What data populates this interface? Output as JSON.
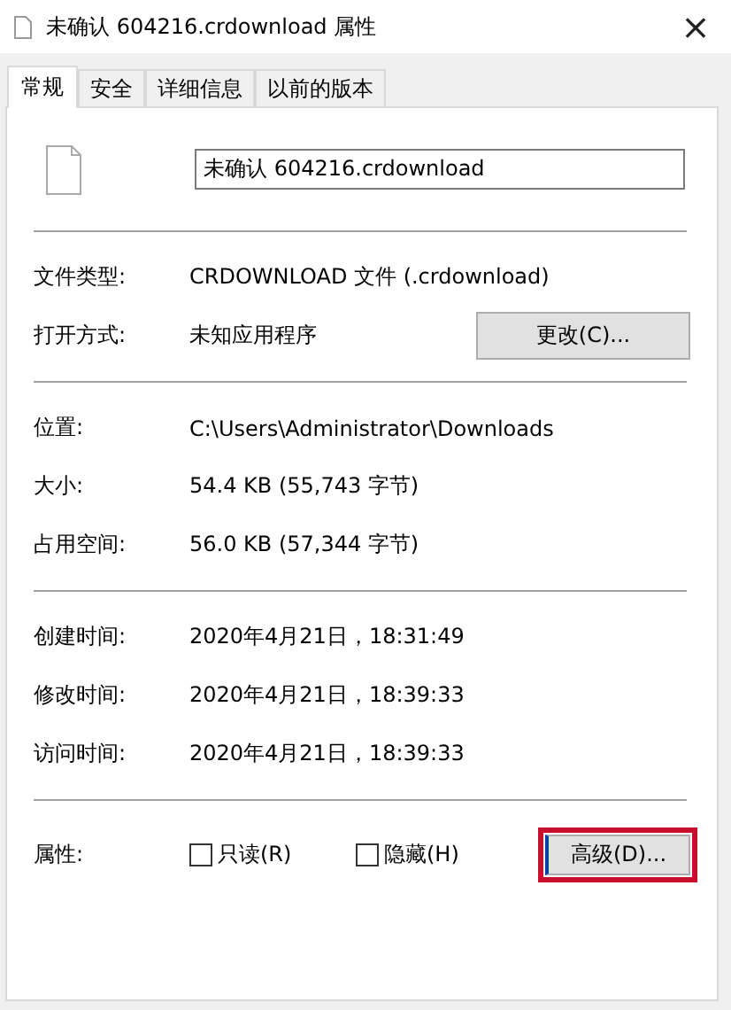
{
  "window": {
    "title": "未确认 604216.crdownload 属性",
    "close": "×"
  },
  "tabs": [
    {
      "label": "常规",
      "selected": true
    },
    {
      "label": "安全",
      "selected": false
    },
    {
      "label": "详细信息",
      "selected": false
    },
    {
      "label": "以前的版本",
      "selected": false
    }
  ],
  "file_name": {
    "value": "未确认 604216.crdownload"
  },
  "groups": [
    {
      "rows": [
        {
          "label": "文件类型:",
          "value": "CRDOWNLOAD 文件 (.crdownload)"
        },
        {
          "label": "打开方式:",
          "value": "未知应用程序",
          "button": {
            "label": "更改(C)..."
          }
        }
      ]
    },
    {
      "rows": [
        {
          "label": "位置:",
          "value": "C:\\Users\\Administrator\\Downloads"
        },
        {
          "label": "大小:",
          "value": "54.4 KB (55,743 字节)"
        },
        {
          "label": "占用空间:",
          "value": "56.0 KB (57,344 字节)"
        }
      ]
    },
    {
      "rows": [
        {
          "label": "创建时间:",
          "value": "2020年4月21日，18:31:49"
        },
        {
          "label": "修改时间:",
          "value": "2020年4月21日，18:39:33"
        },
        {
          "label": "访问时间:",
          "value": "2020年4月21日，18:39:33"
        }
      ]
    }
  ],
  "attributes": {
    "label": "属性:",
    "checkboxes": [
      {
        "label": "只读(R)",
        "checked": false
      },
      {
        "label": "隐藏(H)",
        "checked": false
      }
    ],
    "button": {
      "label": "高级(D)...",
      "highlighted": true
    }
  }
}
